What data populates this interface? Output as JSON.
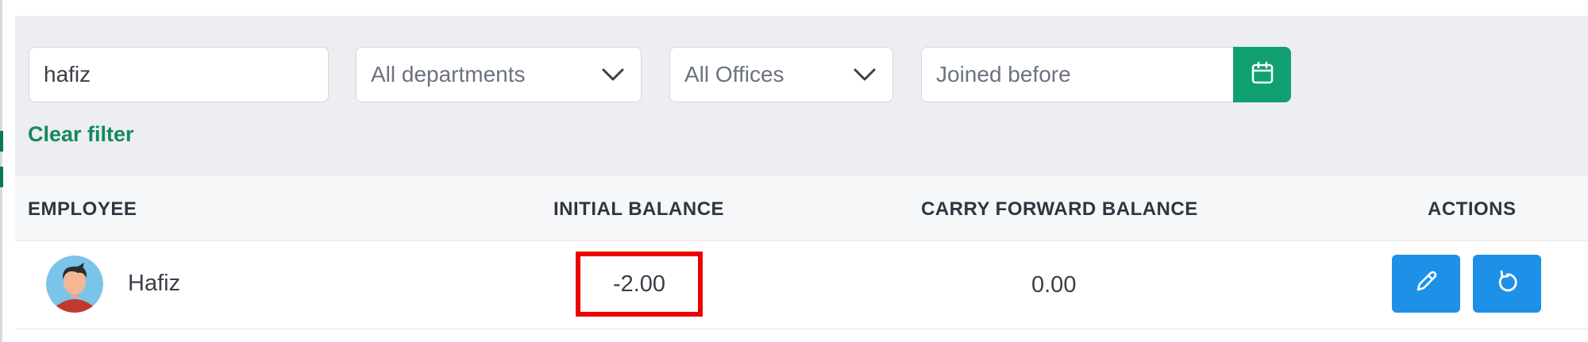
{
  "filters": {
    "search": {
      "value": "hafiz"
    },
    "department": {
      "selected": "All departments"
    },
    "office": {
      "selected": "All Offices"
    },
    "joined_before": {
      "placeholder": "Joined before"
    },
    "clear_filter_label": "Clear filter"
  },
  "table": {
    "headers": {
      "employee": "EMPLOYEE",
      "initial_balance": "INITIAL BALANCE",
      "carry_forward_balance": "CARRY FORWARD BALANCE",
      "actions": "ACTIONS"
    },
    "rows": [
      {
        "employee_name": "Hafiz",
        "initial_balance": "-2.00",
        "carry_forward_balance": "0.00"
      }
    ]
  },
  "icons": {
    "calendar": "calendar-icon",
    "edit": "pencil-icon",
    "reset": "reset-icon",
    "chevron": "chevron-down-icon"
  },
  "colors": {
    "primary_green": "#11a071",
    "clear_filter_green": "#15885e",
    "action_blue": "#1e90e8",
    "highlight_red": "#ee0000",
    "filter_panel_bg": "#eceef2"
  }
}
